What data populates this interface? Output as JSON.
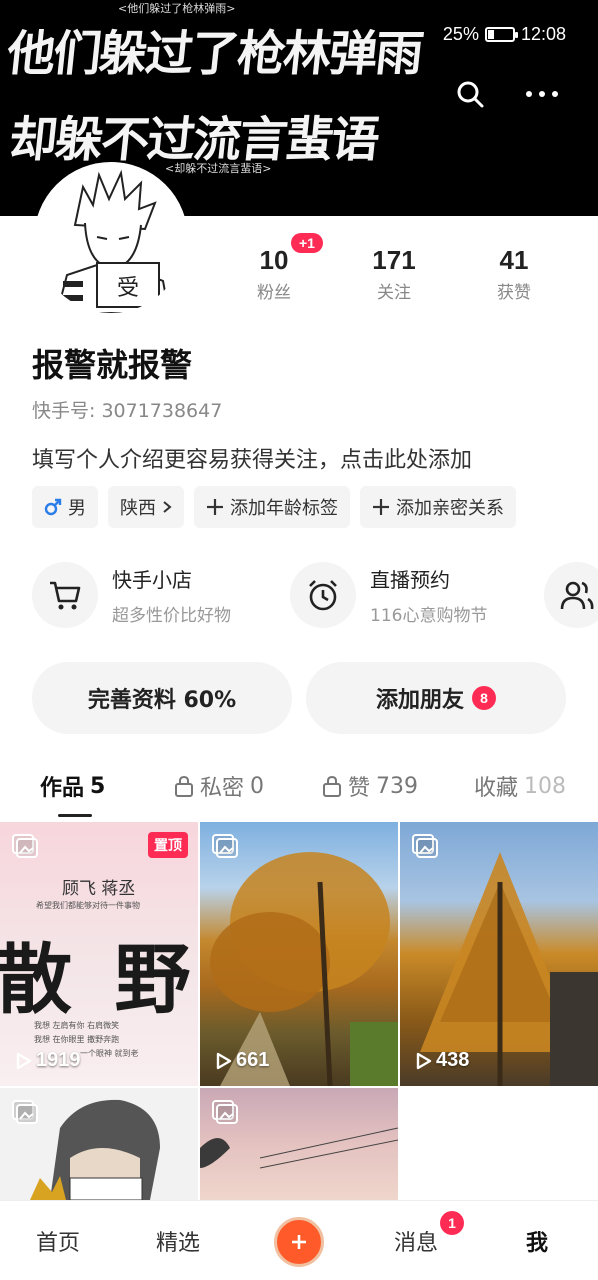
{
  "status_bar": {
    "battery": "25%",
    "time": "12:08"
  },
  "banner": {
    "caption_top": "<他们躲过了枪林弹雨>",
    "line1": "他们躲过了枪林弹雨",
    "line2": "却躲不过流言蜚语",
    "caption_bottom": "<却躲不过流言蜚语>"
  },
  "profile": {
    "avatar_text": "受",
    "username": "报警就报警",
    "kuaishou_id": "快手号: 3071738647",
    "bio": "填写个人介绍更容易获得关注，点击此处添加",
    "stats": [
      {
        "num": "10",
        "label": "粉丝",
        "badge": "+1"
      },
      {
        "num": "171",
        "label": "关注"
      },
      {
        "num": "41",
        "label": "获赞"
      }
    ],
    "tags": {
      "gender": "男",
      "region": "陕西",
      "add_age": "添加年龄标签",
      "add_relation": "添加亲密关系"
    }
  },
  "services": [
    {
      "title": "快手小店",
      "sub": "超多性价比好物",
      "icon": "cart-icon"
    },
    {
      "title": "直播预约",
      "sub": "116心意购物节",
      "icon": "alarm-icon"
    }
  ],
  "actions": {
    "profile_complete": "完善资料 60%",
    "add_friends": "添加朋友",
    "friends_badge": "8"
  },
  "tabs": [
    {
      "label": "作品",
      "count": "5"
    },
    {
      "label": "私密",
      "count": "0"
    },
    {
      "label": "赞",
      "count": "739"
    },
    {
      "label": "收藏",
      "count": "108"
    }
  ],
  "posts": [
    {
      "views": "1919",
      "pinned": "置顶",
      "title_names": "顾飞  蒋丞",
      "title_sub": "希望我们都能够对待一件事物",
      "big_text": "散 野",
      "poem1": "我想 左肩有你 右肩微笑",
      "poem2": "我想 在你眼里 撒野奔跑",
      "poem3": "一个眼神 就到老"
    },
    {
      "views": "661"
    },
    {
      "views": "438"
    },
    {},
    {}
  ],
  "nav": {
    "home": "首页",
    "featured": "精选",
    "messages": "消息",
    "messages_badge": "1",
    "me": "我"
  },
  "colors": {
    "accent": "#fe2c55",
    "add_button": "#ff5a2a"
  }
}
